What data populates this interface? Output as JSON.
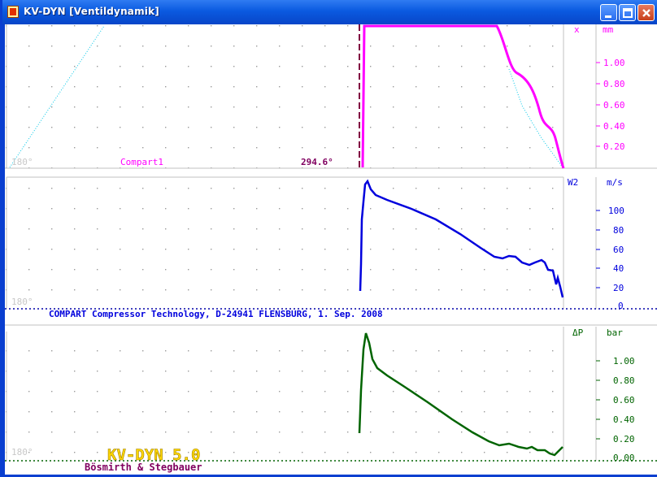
{
  "window": {
    "title": "KV-DYN  [Ventildynamik]",
    "colors": {
      "titlebar": "#0a5ae0",
      "close": "#d9481f"
    }
  },
  "panel1": {
    "axis_symbol": "x",
    "unit": "mm",
    "ticks": [
      "1.00",
      "0.80",
      "0.60",
      "0.40",
      "0.20"
    ],
    "angle_label": "180°",
    "curve_label": "Compart1",
    "marker_label": "294.6°",
    "color": "#ff00ff",
    "label_color": "#800060"
  },
  "panel2": {
    "axis_symbol": "W2",
    "unit": "m/s",
    "ticks": [
      "100",
      "80",
      "60",
      "40",
      "20",
      "0"
    ],
    "angle_label": "180°",
    "footer": "COMPART Compressor Technology, D-24941 FLENSBURG, 1. Sep. 2008",
    "color": "#0000dd"
  },
  "panel3": {
    "axis_symbol": "ΔP",
    "unit": "bar",
    "ticks": [
      "1.00",
      "0.80",
      "0.60",
      "0.40",
      "0.20",
      "0.00"
    ],
    "angle_label": "180°",
    "logo": "KV-DYN 5.0",
    "credits": "Bösmirth & Stegbauer",
    "color": "#006400",
    "logo_color": "#ffd800",
    "credits_color": "#800060"
  }
}
